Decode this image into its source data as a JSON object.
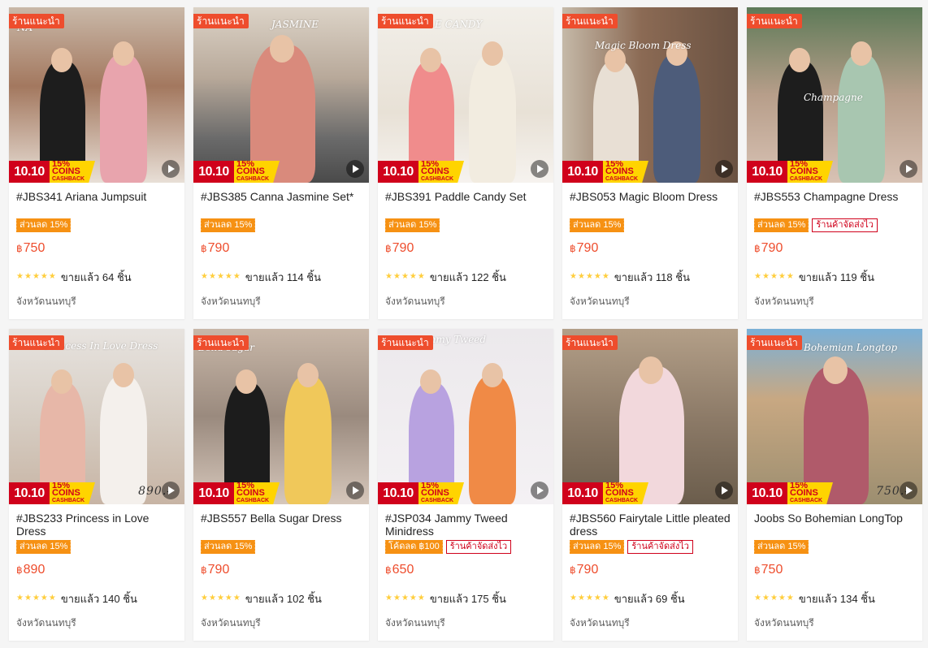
{
  "recommended_badge": "ร้านแนะนำ",
  "campaign": {
    "date": "10.10",
    "cashback_pct": "15%",
    "cashback_label": "CASHBACK",
    "coins_label": "COINS"
  },
  "currency": "฿",
  "colors": {
    "accent": "#ee4d2d",
    "badge": "#ee4d2d",
    "discount": "#f69113",
    "campaign_red": "#d0011b",
    "campaign_yellow": "#ffd400",
    "star": "#ffce3d"
  },
  "products": [
    {
      "name": "#JBS341 Ariana Jumpsuit",
      "tags": [
        "ส่วนลด 15%"
      ],
      "price": "750",
      "sold": "ขายแล้ว 64 ชิ้น",
      "location": "จังหวัดนนทบุรี",
      "overlay_text": "NA",
      "price_overlay": ""
    },
    {
      "name": "#JBS385 Canna Jasmine Set*",
      "tags": [
        "ส่วนลด 15%"
      ],
      "price": "790",
      "sold": "ขายแล้ว 114 ชิ้น",
      "location": "จังหวัดนนทบุรี",
      "overlay_text": "JASMINE",
      "price_overlay": ""
    },
    {
      "name": "#JBS391 Paddle Candy Set",
      "tags": [
        "ส่วนลด 15%"
      ],
      "price": "790",
      "sold": "ขายแล้ว 122 ชิ้น",
      "location": "จังหวัดนนทบุรี",
      "overlay_text": "E CANDY",
      "price_overlay": ""
    },
    {
      "name": "#JBS053 Magic Bloom Dress",
      "tags": [
        "ส่วนลด 15%"
      ],
      "price": "790",
      "sold": "ขายแล้ว 118 ชิ้น",
      "location": "จังหวัดนนทบุรี",
      "overlay_text": "Magic Bloom Dress",
      "price_overlay": ""
    },
    {
      "name": "#JBS553 Champagne Dress",
      "tags": [
        "ส่วนลด 15%",
        "ร้านค้าจัดส่งไว"
      ],
      "price": "790",
      "sold": "ขายแล้ว 119 ชิ้น",
      "location": "จังหวัดนนทบุรี",
      "overlay_text": "Champagne",
      "price_overlay": ""
    },
    {
      "name": "#JBS233 Princess in Love Dress",
      "tags": [
        "ส่วนลด 15%"
      ],
      "price": "890",
      "sold": "ขายแล้ว 140 ชิ้น",
      "location": "จังหวัดนนทบุรี",
      "overlay_text": "Princess In Love Dress",
      "price_overlay": "890.-"
    },
    {
      "name": "#JBS557 Bella Sugar Dress",
      "tags": [
        "ส่วนลด 15%"
      ],
      "price": "790",
      "sold": "ขายแล้ว 102 ชิ้น",
      "location": "จังหวัดนนทบุรี",
      "overlay_text": "Bella sugar",
      "price_overlay": ""
    },
    {
      "name": "#JSP034 Jammy Tweed Minidress",
      "tags": [
        "โค้ดลด ฿100",
        "ร้านค้าจัดส่งไว"
      ],
      "price": "650",
      "sold": "ขายแล้ว 175 ชิ้น",
      "location": "จังหวัดนนทบุรี",
      "overlay_text": "mmy Tweed",
      "price_overlay": ""
    },
    {
      "name": "#JBS560 Fairytale Little pleated dress",
      "tags": [
        "ส่วนลด 15%",
        "ร้านค้าจัดส่งไว"
      ],
      "price": "790",
      "sold": "ขายแล้ว 69 ชิ้น",
      "location": "จังหวัดนนทบุรี",
      "overlay_text": "",
      "price_overlay": ""
    },
    {
      "name": "Joobs So Bohemian LongTop",
      "tags": [
        "ส่วนลด 15%"
      ],
      "price": "750",
      "sold": "ขายแล้ว 134 ชิ้น",
      "location": "จังหวัดนนทบุรี",
      "overlay_text": "Bohemian Longtop",
      "price_overlay": "750.-"
    }
  ]
}
